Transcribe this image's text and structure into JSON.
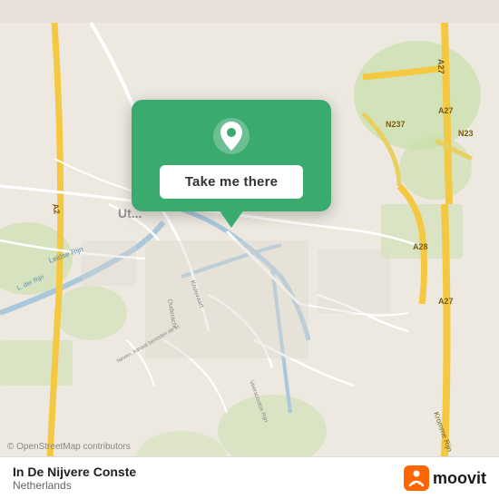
{
  "map": {
    "background_color": "#e8e0d8",
    "center_lat": 52.09,
    "center_lon": 5.12,
    "city_label": "Utrecht"
  },
  "popup": {
    "button_label": "Take me there",
    "background_color": "#3aaa6e"
  },
  "bottom_bar": {
    "location_name": "In De Nijvere Conste",
    "location_country": "Netherlands",
    "osm_credit": "© OpenStreetMap contributors"
  },
  "moovit": {
    "label": "moovit"
  }
}
